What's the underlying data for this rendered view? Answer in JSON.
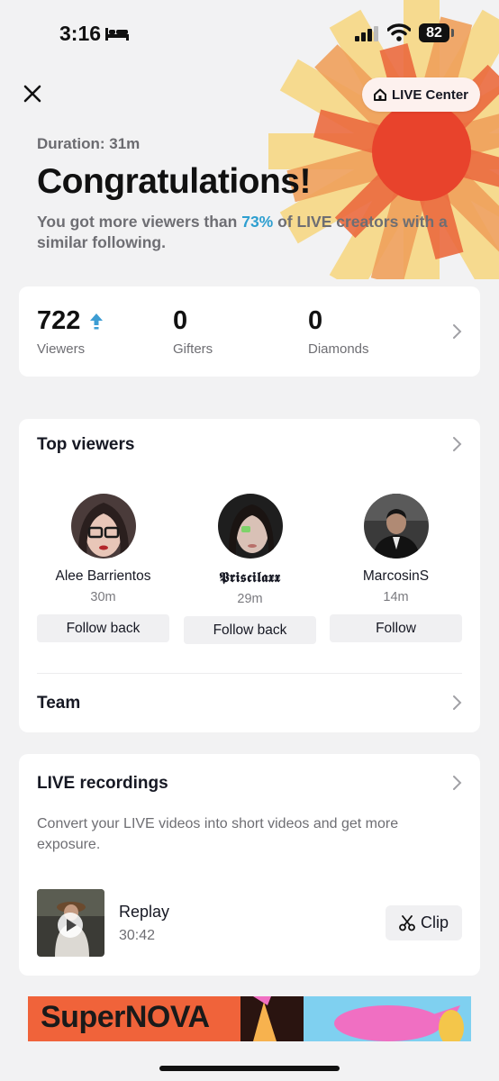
{
  "status_bar": {
    "time": "3:16",
    "battery": "82"
  },
  "header": {
    "live_center_label": "LIVE Center"
  },
  "summary": {
    "duration": "Duration: 31m",
    "headline": "Congratulations!",
    "subtitle_before": "You got more viewers than ",
    "subtitle_percent": "73%",
    "subtitle_after": " of LIVE creators with a similar following."
  },
  "stats": [
    {
      "value": "722",
      "label": "Viewers"
    },
    {
      "value": "0",
      "label": "Gifters"
    },
    {
      "value": "0",
      "label": "Diamonds"
    }
  ],
  "top_viewers": {
    "title": "Top viewers",
    "viewers": [
      {
        "name": "Alee Barrientos",
        "time": "30m",
        "button": "Follow back"
      },
      {
        "name": "𝕻𝖗𝖎𝖘𝖈𝖎𝖑𝖆𝖝𝖝",
        "time": "29m",
        "button": "Follow back"
      },
      {
        "name": "MarcosinS",
        "time": "14m",
        "button": "Follow"
      }
    ],
    "team_label": "Team"
  },
  "recordings": {
    "title": "LIVE recordings",
    "description": "Convert your LIVE videos into short videos and get more exposure.",
    "replay_title": "Replay",
    "replay_duration": "30:42",
    "clip_label": "Clip"
  },
  "banner": {
    "text": "SuperNOVA"
  },
  "colors": {
    "accent": "#2e9fd0",
    "burst_yellow": "#f7c96a",
    "burst_orange": "#ef8a4e",
    "burst_red": "#e8432c"
  },
  "icons": [
    "bed-icon",
    "signal-icon",
    "wifi-icon",
    "close-icon",
    "home-icon",
    "arrow-up-icon",
    "chevron-right-icon",
    "play-icon",
    "scissors-icon"
  ]
}
